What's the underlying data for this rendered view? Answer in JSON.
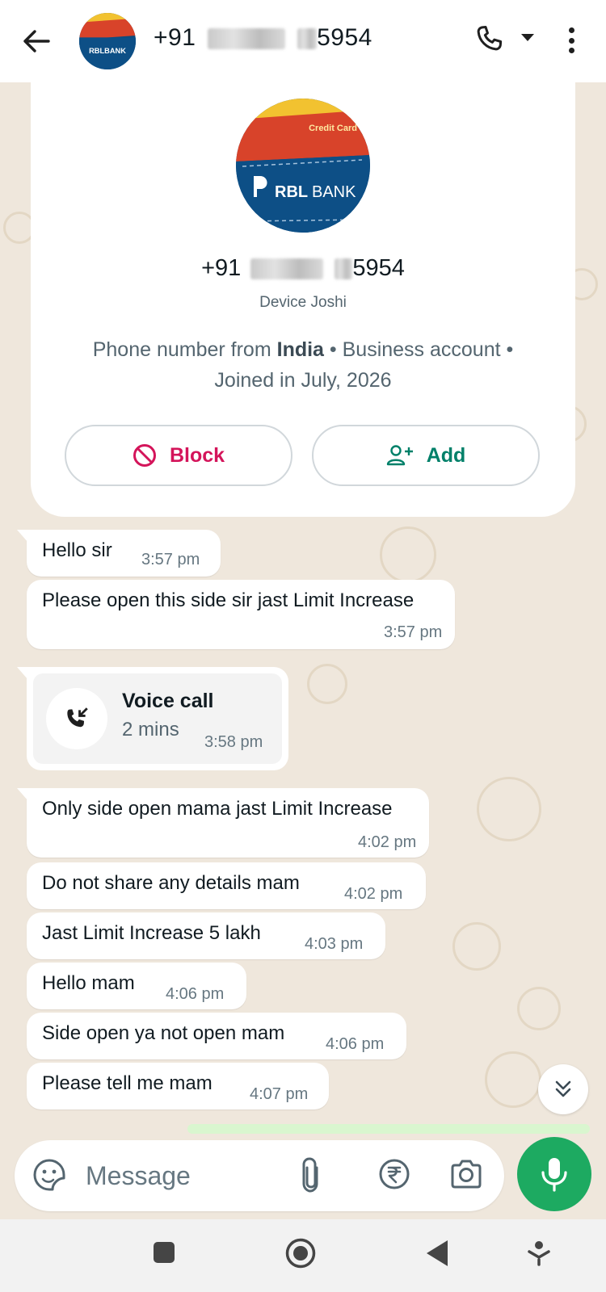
{
  "header": {
    "contact_prefix": "+91",
    "contact_suffix": "5954",
    "avatar_brand": "RBLBANK",
    "avatar_card_label": "Credit Card"
  },
  "profile": {
    "phone_prefix": "+91",
    "phone_suffix": "5954",
    "name": "Device Joshi",
    "info_prefix": "Phone number from ",
    "info_country": "India",
    "info_rest": " • Business account •",
    "info_joined": "Joined in July, 2026",
    "block_label": "Block",
    "add_label": "Add"
  },
  "messages": [
    {
      "text": "Hello sir",
      "time": "3:57 pm"
    },
    {
      "text": "Please open this side sir jast Limit Increase",
      "time": "3:57 pm"
    },
    {
      "text": "Only side open mama jast Limit Increase",
      "time": "4:02 pm"
    },
    {
      "text": "Do not share any details mam",
      "time": "4:02 pm"
    },
    {
      "text": "Jast Limit Increase 5 lakh",
      "time": "4:03 pm"
    },
    {
      "text": "Hello mam",
      "time": "4:06 pm"
    },
    {
      "text": "Side open ya not open mam",
      "time": "4:06 pm"
    },
    {
      "text": "Please tell me mam",
      "time": "4:07 pm"
    }
  ],
  "voice_call": {
    "title": "Voice call",
    "duration": "2 mins",
    "time": "3:58 pm"
  },
  "composer": {
    "placeholder": "Message"
  },
  "colors": {
    "accent_green": "#1daa61",
    "block_red": "#d4145a",
    "add_green": "#008069",
    "chat_bg": "#efe7dc"
  },
  "icons": [
    "back-arrow-icon",
    "phone-icon",
    "dropdown-icon",
    "more-icon",
    "block-icon",
    "add-contact-icon",
    "incoming-call-icon",
    "chevrons-down-icon",
    "sticker-icon",
    "paperclip-icon",
    "rupee-icon",
    "camera-icon",
    "mic-icon"
  ]
}
